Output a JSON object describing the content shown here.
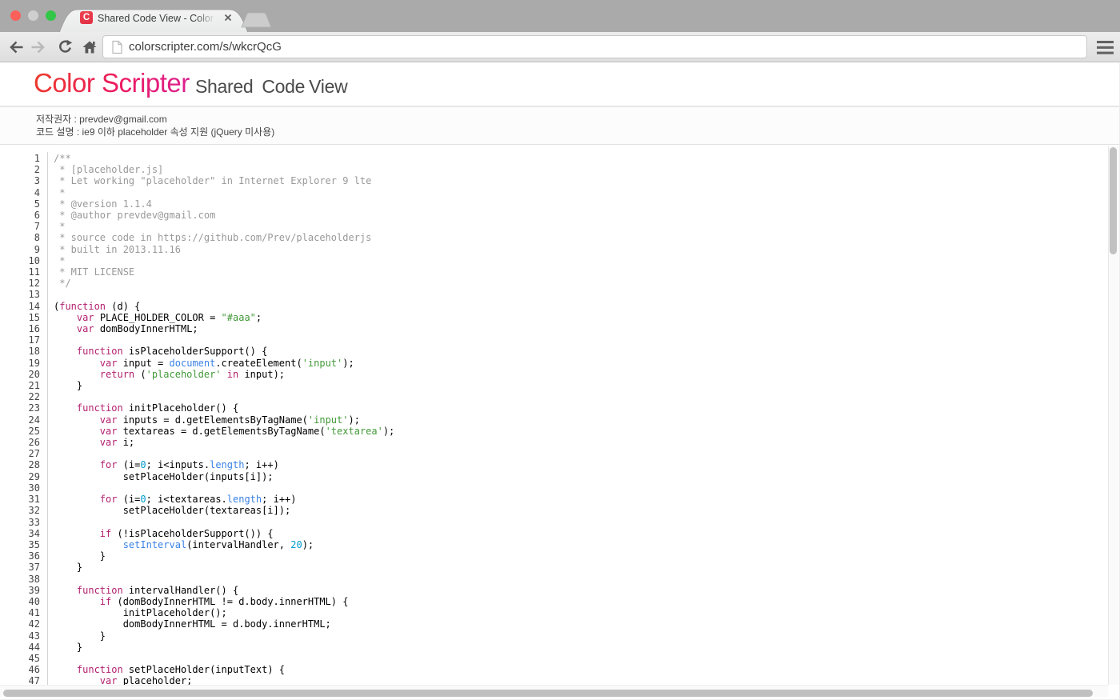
{
  "browser": {
    "traffic_lights": [
      "close",
      "minimize",
      "zoom"
    ],
    "tab": {
      "favicon_letter": "C",
      "title": "Shared Code View - Color Scripter",
      "close_label": "×"
    },
    "url": "colorscripter.com/s/wkcrQcG"
  },
  "header": {
    "brand": "Color Scripter",
    "subtitle": [
      "Shared",
      "Code",
      "View"
    ]
  },
  "info": {
    "line1": "저작권자 : prevdev@gmail.com",
    "line2": "코드 설명 : ie9 이하 placeholder 속성 지원 (jQuery 미사용)"
  },
  "colors": {
    "brand1": "#ec3b28",
    "brand2": "#ec1b62",
    "brand3": "#da2193",
    "comment": "#999999",
    "keyword": "#b21f6e",
    "string": "#429938",
    "blue": "#3b82e6",
    "number": "#009acd"
  },
  "code": {
    "language": "javascript",
    "lines": [
      [
        [
          "c",
          "/**"
        ]
      ],
      [
        [
          "c",
          " * [placeholder.js]"
        ]
      ],
      [
        [
          "c",
          " * Let working \"placeholder\" in Internet Explorer 9 lte"
        ]
      ],
      [
        [
          "c",
          " *"
        ]
      ],
      [
        [
          "c",
          " * @version 1.1.4"
        ]
      ],
      [
        [
          "c",
          " * @author prevdev@gmail.com"
        ]
      ],
      [
        [
          "c",
          " *"
        ]
      ],
      [
        [
          "c",
          " * source code in https://github.com/Prev/placeholderjs"
        ]
      ],
      [
        [
          "c",
          " * built in 2013.11.16"
        ]
      ],
      [
        [
          "c",
          " *"
        ]
      ],
      [
        [
          "c",
          " * MIT LICENSE"
        ]
      ],
      [
        [
          "c",
          " */"
        ]
      ],
      [],
      [
        [
          "p",
          "("
        ],
        [
          "k",
          "function"
        ],
        [
          "p",
          " (d) {"
        ]
      ],
      [
        [
          "p",
          "    "
        ],
        [
          "k",
          "var"
        ],
        [
          "p",
          " PLACE_HOLDER_COLOR = "
        ],
        [
          "s",
          "\"#aaa\""
        ],
        [
          "p",
          ";"
        ]
      ],
      [
        [
          "p",
          "    "
        ],
        [
          "k",
          "var"
        ],
        [
          "p",
          " domBodyInnerHTML;"
        ]
      ],
      [],
      [
        [
          "p",
          "    "
        ],
        [
          "k",
          "function"
        ],
        [
          "p",
          " isPlaceholderSupport() {"
        ]
      ],
      [
        [
          "p",
          "        "
        ],
        [
          "k",
          "var"
        ],
        [
          "p",
          " input = "
        ],
        [
          "b",
          "document"
        ],
        [
          "p",
          ".createElement("
        ],
        [
          "s",
          "'input'"
        ],
        [
          "p",
          ");"
        ]
      ],
      [
        [
          "p",
          "        "
        ],
        [
          "k",
          "return"
        ],
        [
          "p",
          " ("
        ],
        [
          "s",
          "'placeholder'"
        ],
        [
          "p",
          " "
        ],
        [
          "k",
          "in"
        ],
        [
          "p",
          " input);"
        ]
      ],
      [
        [
          "p",
          "    }"
        ]
      ],
      [],
      [
        [
          "p",
          "    "
        ],
        [
          "k",
          "function"
        ],
        [
          "p",
          " initPlaceholder() {"
        ]
      ],
      [
        [
          "p",
          "        "
        ],
        [
          "k",
          "var"
        ],
        [
          "p",
          " inputs = d.getElementsByTagName("
        ],
        [
          "s",
          "'input'"
        ],
        [
          "p",
          ");"
        ]
      ],
      [
        [
          "p",
          "        "
        ],
        [
          "k",
          "var"
        ],
        [
          "p",
          " textareas = d.getElementsByTagName("
        ],
        [
          "s",
          "'textarea'"
        ],
        [
          "p",
          ");"
        ]
      ],
      [
        [
          "p",
          "        "
        ],
        [
          "k",
          "var"
        ],
        [
          "p",
          " i;"
        ]
      ],
      [],
      [
        [
          "p",
          "        "
        ],
        [
          "k",
          "for"
        ],
        [
          "p",
          " (i="
        ],
        [
          "n",
          "0"
        ],
        [
          "p",
          "; i<inputs."
        ],
        [
          "b",
          "length"
        ],
        [
          "p",
          "; i++)"
        ]
      ],
      [
        [
          "p",
          "            setPlaceHolder(inputs[i]);"
        ]
      ],
      [],
      [
        [
          "p",
          "        "
        ],
        [
          "k",
          "for"
        ],
        [
          "p",
          " (i="
        ],
        [
          "n",
          "0"
        ],
        [
          "p",
          "; i<textareas."
        ],
        [
          "b",
          "length"
        ],
        [
          "p",
          "; i++)"
        ]
      ],
      [
        [
          "p",
          "            setPlaceHolder(textareas[i]);"
        ]
      ],
      [],
      [
        [
          "p",
          "        "
        ],
        [
          "k",
          "if"
        ],
        [
          "p",
          " (!isPlaceholderSupport()) {"
        ]
      ],
      [
        [
          "p",
          "            "
        ],
        [
          "b",
          "setInterval"
        ],
        [
          "p",
          "(intervalHandler, "
        ],
        [
          "n",
          "20"
        ],
        [
          "p",
          ");"
        ]
      ],
      [
        [
          "p",
          "        }"
        ]
      ],
      [
        [
          "p",
          "    }"
        ]
      ],
      [],
      [
        [
          "p",
          "    "
        ],
        [
          "k",
          "function"
        ],
        [
          "p",
          " intervalHandler() {"
        ]
      ],
      [
        [
          "p",
          "        "
        ],
        [
          "k",
          "if"
        ],
        [
          "p",
          " (domBodyInnerHTML != d.body.innerHTML) {"
        ]
      ],
      [
        [
          "p",
          "            initPlaceholder();"
        ]
      ],
      [
        [
          "p",
          "            domBodyInnerHTML = d.body.innerHTML;"
        ]
      ],
      [
        [
          "p",
          "        }"
        ]
      ],
      [
        [
          "p",
          "    }"
        ]
      ],
      [],
      [
        [
          "p",
          "    "
        ],
        [
          "k",
          "function"
        ],
        [
          "p",
          " setPlaceHolder(inputText) {"
        ]
      ],
      [
        [
          "p",
          "        "
        ],
        [
          "k",
          "var"
        ],
        [
          "p",
          " placeholder;"
        ]
      ]
    ]
  }
}
